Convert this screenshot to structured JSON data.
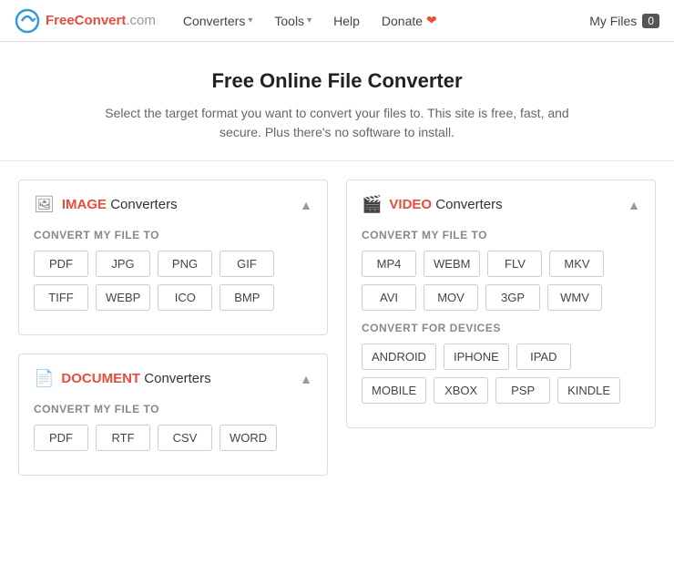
{
  "header": {
    "logo_text": "FreeConvert",
    "logo_domain": ".com",
    "nav": [
      {
        "label": "Converters",
        "has_dropdown": true
      },
      {
        "label": "Tools",
        "has_dropdown": true
      },
      {
        "label": "Help",
        "has_dropdown": false
      }
    ],
    "donate_label": "Donate",
    "my_files_label": "My Files",
    "my_files_count": "0"
  },
  "hero": {
    "title": "Free Online File Converter",
    "subtitle": "Select the target format you want to convert your files to. This site is free, fast, and secure. Plus there's no software to install."
  },
  "converters": [
    {
      "id": "image",
      "keyword": "IMAGE",
      "label": "Converters",
      "convert_label": "Convert My File To",
      "formats": [
        "PDF",
        "JPG",
        "PNG",
        "GIF",
        "TIFF",
        "WEBP",
        "ICO",
        "BMP"
      ],
      "devices": []
    },
    {
      "id": "video",
      "keyword": "VIDEO",
      "label": "Converters",
      "convert_label": "Convert My File To",
      "formats": [
        "MP4",
        "WEBM",
        "FLV",
        "MKV",
        "AVI",
        "MOV",
        "3GP",
        "WMV"
      ],
      "devices_label": "Convert for devices",
      "devices": [
        "ANDROID",
        "IPHONE",
        "IPAD",
        "MOBILE",
        "XBOX",
        "PSP",
        "KINDLE"
      ]
    },
    {
      "id": "document",
      "keyword": "DOCUMENT",
      "label": "Converters",
      "convert_label": "Convert My File To",
      "formats": [
        "PDF",
        "RTF",
        "CSV",
        "WORD"
      ],
      "devices": []
    }
  ]
}
